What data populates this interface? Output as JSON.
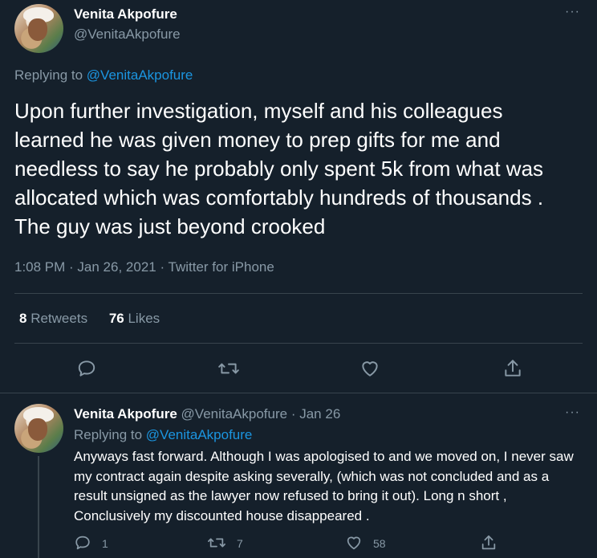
{
  "main_tweet": {
    "display_name": "Venita Akpofure",
    "handle": "@VenitaAkpofure",
    "replying_prefix": "Replying to",
    "replying_handle": "@VenitaAkpofure",
    "text": "Upon further investigation, myself and his colleagues learned he was given money to prep gifts for me and needless to say he probably only spent 5k from what was allocated which was comfortably hundreds of thousands . The guy was just beyond crooked",
    "meta": "1:08 PM · Jan 26, 2021 · Twitter for iPhone",
    "retweets_count": "8",
    "retweets_label": "Retweets",
    "likes_count": "76",
    "likes_label": "Likes",
    "more_glyph": "···"
  },
  "reply_tweet": {
    "display_name": "Venita Akpofure",
    "handle": "@VenitaAkpofure",
    "date": "· Jan 26",
    "replying_prefix": "Replying to",
    "replying_handle": "@VenitaAkpofure",
    "text": "Anyways fast forward. Although I was apologised to and we moved on, I never saw my contract again despite asking severally, (which was not concluded and as a result unsigned as the lawyer now refused to bring it out). Long n short , Conclusively my discounted house disappeared .",
    "reply_count": "1",
    "retweet_count": "7",
    "like_count": "58",
    "more_glyph": "···"
  },
  "icons": {
    "reply": "reply-icon",
    "retweet": "retweet-icon",
    "like": "heart-icon",
    "share": "share-icon",
    "more": "more-icon"
  },
  "colors": {
    "background": "#15202b",
    "text": "#ffffff",
    "muted": "#8899a6",
    "link": "#1b95e0",
    "divider": "#38444d"
  }
}
